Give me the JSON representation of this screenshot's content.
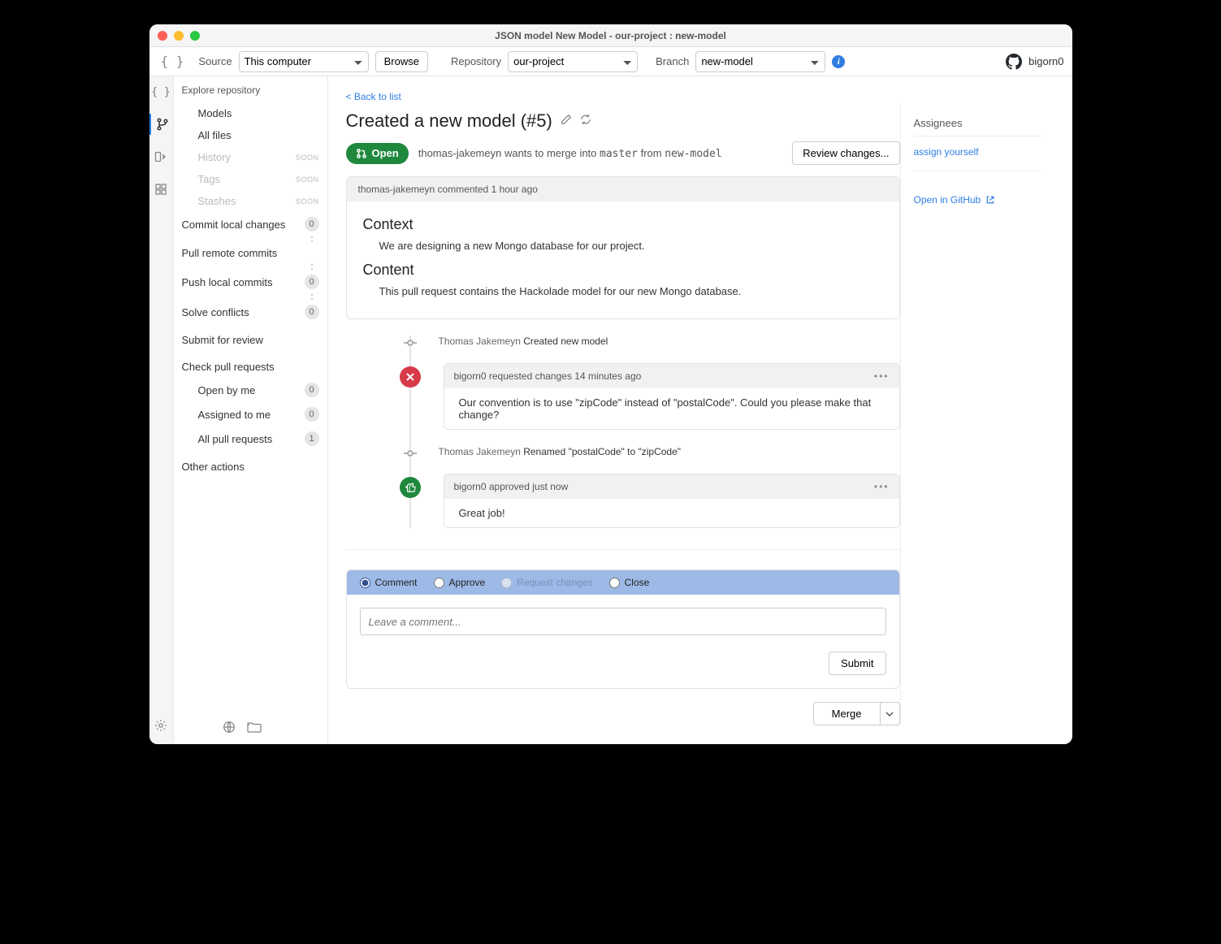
{
  "window": {
    "title": "JSON model New Model - our-project : new-model"
  },
  "toolbar": {
    "source_label": "Source",
    "source_value": "This computer",
    "browse": "Browse",
    "repo_label": "Repository",
    "repo_value": "our-project",
    "branch_label": "Branch",
    "branch_value": "new-model",
    "user": "bigorn0"
  },
  "sidebar": {
    "header": "Explore repository",
    "models": "Models",
    "all_files": "All files",
    "history": "History",
    "tags": "Tags",
    "stashes": "Stashes",
    "soon": "SOON",
    "commit_local": "Commit local changes",
    "pull_remote": "Pull remote commits",
    "push_local": "Push local commits",
    "solve_conflicts": "Solve conflicts",
    "submit_review": "Submit for review",
    "check_prs": "Check pull requests",
    "open_by_me": "Open by me",
    "assigned_to_me": "Assigned to me",
    "all_prs": "All pull requests",
    "other_actions": "Other actions",
    "counts": {
      "commit": "0",
      "push": "0",
      "conflicts": "0",
      "open_by_me": "0",
      "assigned": "0",
      "all_prs": "1"
    }
  },
  "pr": {
    "back": "< Back to list",
    "title": "Created a new model (#5)",
    "state": "Open",
    "author": "thomas-jakemeyn",
    "wants": " wants to merge into ",
    "base": "master",
    "from": " from ",
    "head": "new-model",
    "review_changes": "Review changes...",
    "assignees": "Assignees",
    "assign_self": "assign yourself",
    "open_gh": "Open in GitHub",
    "merge": "Merge"
  },
  "desc": {
    "head": "thomas-jakemeyn commented 1 hour ago",
    "h1": "Context",
    "p1": "We are designing a new Mongo database for our project.",
    "h2": "Content",
    "p2": "This pull request contains the Hackolade model for our new Mongo database."
  },
  "timeline": {
    "commit1_author": "Thomas Jakemeyn ",
    "commit1_msg": "Created new model",
    "rev1_head": "bigorn0 requested changes 14 minutes ago",
    "rev1_body": "Our convention is to use \"zipCode\" instead of \"postalCode\". Could you please make that change?",
    "commit2_author": "Thomas Jakemeyn ",
    "commit2_msg": "Renamed \"postalCode\" to \"zipCode\"",
    "rev2_head": "bigorn0 approved just now",
    "rev2_body": "Great job!"
  },
  "review": {
    "comment": "Comment",
    "approve": "Approve",
    "request": "Request changes",
    "close": "Close",
    "placeholder": "Leave a comment...",
    "submit": "Submit"
  }
}
